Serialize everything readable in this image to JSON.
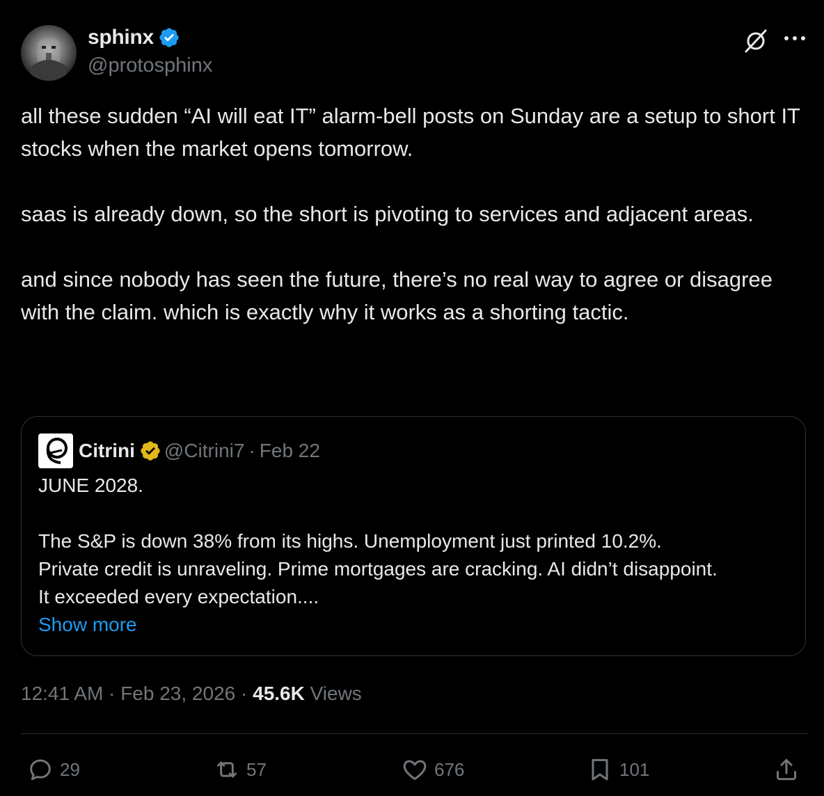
{
  "author": {
    "name": "sphinx",
    "handle": "@protosphinx",
    "verified_color": "#1d9bf0"
  },
  "tweet": {
    "paragraphs": [
      "all these sudden “AI will eat IT” alarm-bell posts on Sunday are a setup to short IT stocks when the market opens tomorrow.",
      "saas is already down, so the short is pivoting to services and adjacent areas.",
      "and since nobody has seen the future, there’s no real way to agree or disagree with the claim. which is exactly why it works as a shorting tactic."
    ]
  },
  "quote": {
    "name": "Citrini",
    "handle": "@Citrini7",
    "separator": "·",
    "date": "Feb 22",
    "badge_color": "#e2b719",
    "lines": [
      "JUNE 2028.",
      "The S&P is down 38% from its highs. Unemployment just printed 10.2%.",
      "Private credit is unraveling. Prime mortgages are cracking. AI didn’t disappoint.",
      "It exceeded every expectation...."
    ],
    "show_more": "Show more"
  },
  "meta": {
    "time": "12:41 AM",
    "separator": "·",
    "date": "Feb 23, 2026",
    "views_count": "45.6K",
    "views_label": "Views"
  },
  "actions": {
    "replies": "29",
    "reposts": "57",
    "likes": "676",
    "bookmarks": "101"
  },
  "icons": {
    "menu": "grok-icon",
    "more": "more-icon",
    "reply": "reply-icon",
    "repost": "repost-icon",
    "like": "heart-icon",
    "bookmark": "bookmark-icon",
    "share": "share-icon"
  },
  "colors": {
    "background": "#000000",
    "text": "#e7e9ea",
    "muted": "#71767b",
    "link": "#1d9bf0",
    "border": "#2f3336"
  }
}
